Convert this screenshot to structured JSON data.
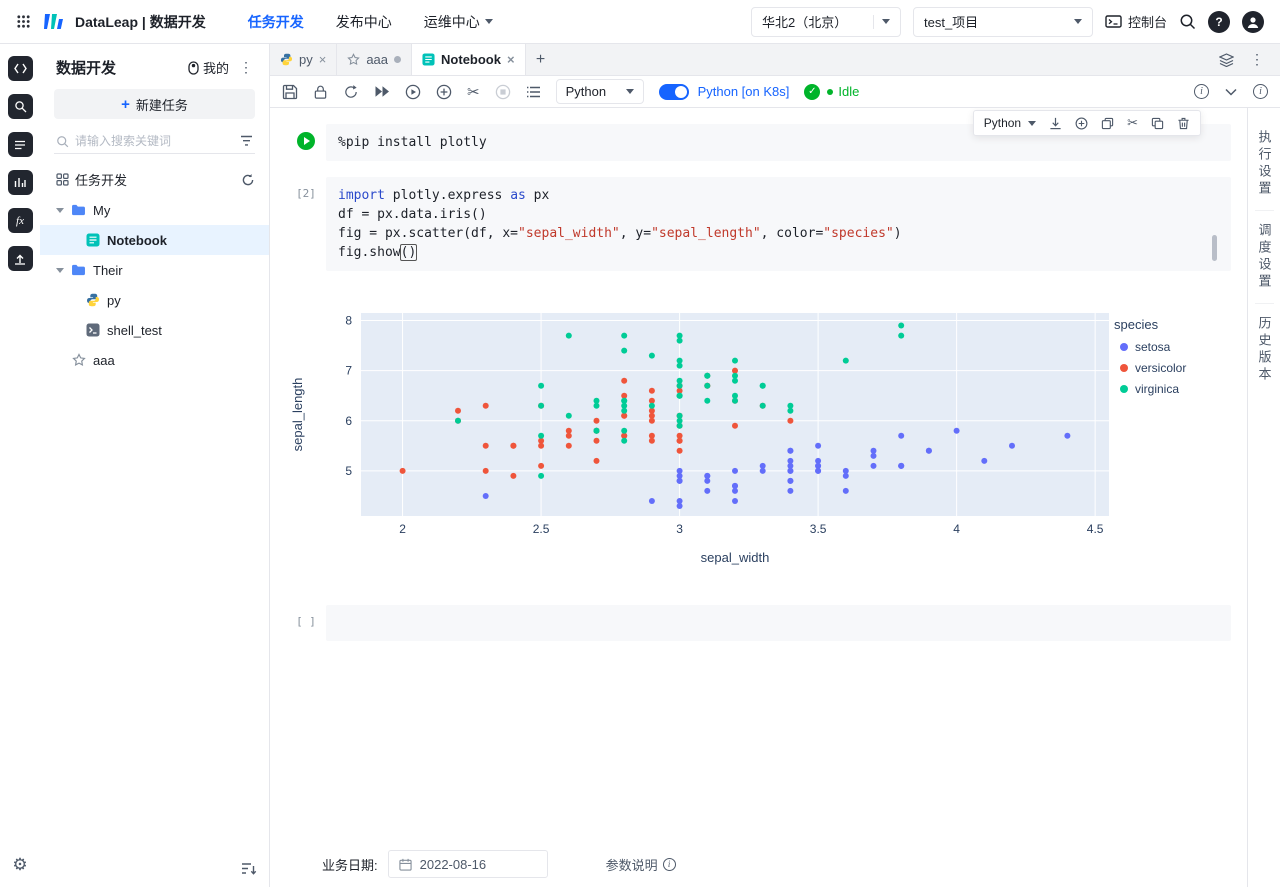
{
  "header": {
    "product_title": "DataLeap | 数据开发",
    "nav": {
      "items": [
        {
          "label": "任务开发",
          "active": true
        },
        {
          "label": "发布中心",
          "active": false
        },
        {
          "label": "运维中心",
          "active": false
        }
      ]
    },
    "region_select": {
      "value": "华北2（北京）"
    },
    "project_select": {
      "value": "test_项目"
    },
    "console_label": "控制台"
  },
  "sidebar": {
    "title": "数据开发",
    "mine_toggle_label": "我的",
    "new_task_button": "新建任务",
    "search_placeholder": "请输入搜索关键词",
    "section_title": "任务开发",
    "tree": [
      {
        "label": "My",
        "type": "folder",
        "expanded": true
      },
      {
        "label": "Notebook",
        "type": "notebook",
        "selected": true
      },
      {
        "label": "Their",
        "type": "folder",
        "expanded": true
      },
      {
        "label": "py",
        "type": "python"
      },
      {
        "label": "shell_test",
        "type": "shell"
      },
      {
        "label": "aaa",
        "type": "starred"
      }
    ]
  },
  "tabs": {
    "items": [
      {
        "label": "py",
        "icon": "python-icon",
        "close": true,
        "active": false
      },
      {
        "label": "aaa",
        "icon": "star-icon",
        "dirty": true,
        "active": false
      },
      {
        "label": "Notebook",
        "icon": "notebook-icon",
        "close": true,
        "active": true
      }
    ]
  },
  "toolbar": {
    "language_select": "Python",
    "kernel_toggle_label": "Python [on K8s]",
    "kernel_status": "Idle"
  },
  "cell_toolbar": {
    "language_select": "Python"
  },
  "right_panel": {
    "items": [
      "执行设置",
      "调度设置",
      "历史版本"
    ]
  },
  "notebook": {
    "cell1": {
      "lines": [
        [
          {
            "t": "%pip",
            "c": "magic"
          },
          {
            "t": " install plotly",
            "c": "plain"
          }
        ]
      ]
    },
    "cell2": {
      "gutter": "[2]",
      "lines": [
        [
          {
            "t": "import",
            "c": "kw"
          },
          {
            "t": " plotly.express ",
            "c": "plain"
          },
          {
            "t": "as",
            "c": "kw"
          },
          {
            "t": " px",
            "c": "plain"
          }
        ],
        [
          {
            "t": "df = px.data.iris()",
            "c": "plain"
          }
        ],
        [
          {
            "t": "fig = px.scatter(df, x=",
            "c": "plain"
          },
          {
            "t": "\"sepal_width\"",
            "c": "str"
          },
          {
            "t": ", y=",
            "c": "plain"
          },
          {
            "t": "\"sepal_length\"",
            "c": "str"
          },
          {
            "t": ", color=",
            "c": "plain"
          },
          {
            "t": "\"species\"",
            "c": "str"
          },
          {
            "t": ")",
            "c": "plain"
          }
        ],
        [
          {
            "t": "fig.show",
            "c": "plain"
          },
          {
            "t": "()",
            "c": "boxed"
          }
        ]
      ]
    },
    "empty_cell_gutter": "[ ]"
  },
  "chart_data": {
    "type": "scatter",
    "xlabel": "sepal_width",
    "ylabel": "sepal_length",
    "xlim": [
      1.85,
      4.55
    ],
    "ylim": [
      4.1,
      8.15
    ],
    "xticks": [
      2,
      2.5,
      3,
      3.5,
      4,
      4.5
    ],
    "yticks": [
      5,
      6,
      7,
      8
    ],
    "legend_title": "species",
    "plot_bg": "#E5ECF6",
    "grid": true,
    "legend_position": "right",
    "series": [
      {
        "name": "setosa",
        "color": "#636EFA",
        "x": [
          3.5,
          3.0,
          3.2,
          3.1,
          3.6,
          3.9,
          3.4,
          3.4,
          2.9,
          3.1,
          3.7,
          3.4,
          3.0,
          3.0,
          4.0,
          4.4,
          3.9,
          3.5,
          3.8,
          3.8,
          3.4,
          3.7,
          3.6,
          3.3,
          3.4,
          3.0,
          3.4,
          3.5,
          3.4,
          3.2,
          3.1,
          3.4,
          4.1,
          4.2,
          3.1,
          3.2,
          3.5,
          3.6,
          3.0,
          3.4,
          3.5,
          2.3,
          3.2,
          3.5,
          3.8,
          3.0,
          3.8,
          3.2,
          3.7,
          3.3
        ],
        "y": [
          5.1,
          4.9,
          4.7,
          4.6,
          5.0,
          5.4,
          4.6,
          5.0,
          4.4,
          4.9,
          5.4,
          4.8,
          4.8,
          4.3,
          5.8,
          5.7,
          5.4,
          5.1,
          5.7,
          5.1,
          5.4,
          5.1,
          4.6,
          5.1,
          4.8,
          5.0,
          5.0,
          5.2,
          5.2,
          4.7,
          4.8,
          5.4,
          5.2,
          5.5,
          4.9,
          5.0,
          5.5,
          4.9,
          4.4,
          5.1,
          5.0,
          4.5,
          4.4,
          5.0,
          5.1,
          4.8,
          5.1,
          4.6,
          5.3,
          5.0
        ]
      },
      {
        "name": "versicolor",
        "color": "#EF553B",
        "x": [
          3.2,
          3.2,
          3.1,
          2.3,
          2.8,
          2.8,
          3.3,
          2.4,
          2.9,
          2.7,
          2.0,
          3.0,
          2.2,
          2.9,
          2.9,
          3.1,
          3.0,
          2.7,
          2.2,
          2.5,
          3.2,
          2.8,
          2.5,
          2.8,
          2.9,
          3.0,
          2.8,
          3.0,
          2.9,
          2.6,
          2.4,
          2.4,
          2.7,
          2.7,
          3.0,
          3.4,
          3.1,
          2.3,
          3.0,
          2.5,
          2.6,
          3.0,
          2.6,
          2.3,
          2.7,
          3.0,
          2.9,
          2.9,
          2.5,
          2.8
        ],
        "y": [
          7.0,
          6.4,
          6.9,
          5.5,
          6.5,
          5.7,
          6.3,
          4.9,
          6.6,
          5.2,
          5.0,
          5.9,
          6.0,
          6.1,
          5.6,
          6.7,
          5.6,
          5.8,
          6.2,
          5.6,
          5.9,
          6.1,
          6.3,
          6.1,
          6.4,
          6.6,
          6.8,
          6.7,
          6.0,
          5.7,
          5.5,
          5.5,
          5.8,
          6.0,
          5.4,
          6.0,
          6.7,
          6.3,
          5.6,
          5.5,
          5.5,
          6.1,
          5.8,
          5.0,
          5.6,
          5.7,
          5.7,
          6.2,
          5.1,
          5.7
        ]
      },
      {
        "name": "virginica",
        "color": "#00CC96",
        "x": [
          3.3,
          2.7,
          3.0,
          2.9,
          3.0,
          3.0,
          2.5,
          2.9,
          2.5,
          3.6,
          3.2,
          2.7,
          3.0,
          2.5,
          2.8,
          3.2,
          3.0,
          3.8,
          2.6,
          2.2,
          3.2,
          2.8,
          2.8,
          2.7,
          3.3,
          3.2,
          2.8,
          3.0,
          2.8,
          3.0,
          2.8,
          3.8,
          2.8,
          2.8,
          2.6,
          3.0,
          3.4,
          3.1,
          3.0,
          3.1,
          3.1,
          3.1,
          2.7,
          3.2,
          3.3,
          3.0,
          2.5,
          3.0,
          3.4,
          3.0
        ],
        "y": [
          6.3,
          5.8,
          7.1,
          6.3,
          6.5,
          7.6,
          4.9,
          7.3,
          6.7,
          7.2,
          6.5,
          6.4,
          6.8,
          5.7,
          5.8,
          6.4,
          6.5,
          7.7,
          7.7,
          6.0,
          6.9,
          5.6,
          7.7,
          6.3,
          6.7,
          7.2,
          6.2,
          6.1,
          6.4,
          7.2,
          7.4,
          7.9,
          6.4,
          6.3,
          6.1,
          7.7,
          6.3,
          6.4,
          6.0,
          6.9,
          6.7,
          6.9,
          5.8,
          6.8,
          6.7,
          6.7,
          6.3,
          6.5,
          6.2,
          5.9
        ]
      }
    ]
  },
  "footer": {
    "date_label": "业务日期:",
    "date_value": "2022-08-16",
    "params_label": "参数说明"
  }
}
